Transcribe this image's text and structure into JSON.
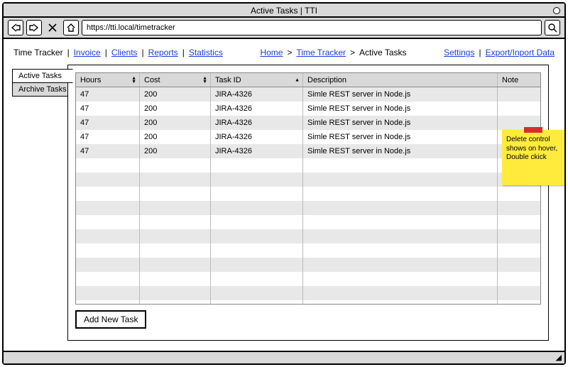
{
  "window": {
    "title": "Active Tasks | TTI"
  },
  "browser": {
    "url": "https://tti.local/timetracker"
  },
  "nav": {
    "items": [
      {
        "label": "Time Tracker",
        "active": true
      },
      {
        "label": "Invoice"
      },
      {
        "label": "Clients"
      },
      {
        "label": "Reports"
      },
      {
        "label": "Statistics"
      }
    ],
    "right": [
      {
        "label": "Settings"
      },
      {
        "label": "Export/Inport Data"
      }
    ]
  },
  "breadcrumb": [
    {
      "label": "Home",
      "link": true
    },
    {
      "label": "Time Tracker",
      "link": true
    },
    {
      "label": "Active Tasks",
      "link": false
    }
  ],
  "sideTabs": [
    {
      "label": "Active Tasks",
      "active": true
    },
    {
      "label": "Archive Tasks",
      "active": false
    }
  ],
  "table": {
    "headers": [
      "Hours",
      "Cost",
      "Task ID",
      "Description",
      "Note"
    ],
    "rows": [
      {
        "hours": "47",
        "cost": "200",
        "task": "JIRA-4326",
        "desc": "Simle REST server in Node.js",
        "note": ""
      },
      {
        "hours": "47",
        "cost": "200",
        "task": "JIRA-4326",
        "desc": "Simle REST server in Node.js",
        "note": ""
      },
      {
        "hours": "47",
        "cost": "200",
        "task": "JIRA-4326",
        "desc": "Simle REST server in Node.js",
        "note": ""
      },
      {
        "hours": "47",
        "cost": "200",
        "task": "JIRA-4326",
        "desc": "Simle REST server in Node.js",
        "note": ""
      },
      {
        "hours": "47",
        "cost": "200",
        "task": "JIRA-4326",
        "desc": "Simle REST server in Node.js",
        "note": ""
      }
    ],
    "emptyRows": 11
  },
  "buttons": {
    "addNewTask": "Add New Task"
  },
  "sticky": {
    "text": "Delete control shows on hover, Double ckick"
  }
}
